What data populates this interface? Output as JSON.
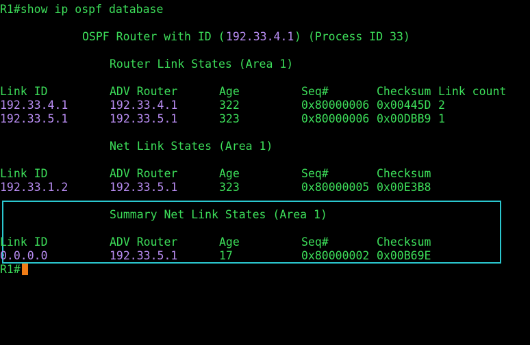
{
  "colors": {
    "background": "#000000",
    "text_green": "#3ddf5a",
    "ip_purple": "#b98df3",
    "highlight_box": "#2bc7cf",
    "cursor": "#f07c16"
  },
  "command_line": "R1#show ip ospf database",
  "header": {
    "prefix": "OSPF Router with ID (",
    "router_id": "192.33.4.1",
    "suffix": ") (Process ID 33)"
  },
  "router_section": {
    "title": "Router Link States (Area 1)",
    "columns": {
      "link_id": "Link ID",
      "adv_router": "ADV Router",
      "age": "Age",
      "seq": "Seq#",
      "checksum": "Checksum",
      "link_count": "Link count"
    },
    "rows": [
      {
        "link_id": "192.33.4.1",
        "adv_router": "192.33.4.1",
        "age": "322",
        "seq": "0x80000006",
        "checksum": "0x00445D",
        "link_count": "2"
      },
      {
        "link_id": "192.33.5.1",
        "adv_router": "192.33.5.1",
        "age": "323",
        "seq": "0x80000006",
        "checksum": "0x00DBB9",
        "link_count": "1"
      }
    ]
  },
  "net_section": {
    "title": "Net Link States (Area 1)",
    "columns": {
      "link_id": "Link ID",
      "adv_router": "ADV Router",
      "age": "Age",
      "seq": "Seq#",
      "checksum": "Checksum"
    },
    "rows": [
      {
        "link_id": "192.33.1.2",
        "adv_router": "192.33.5.1",
        "age": "323",
        "seq": "0x80000005",
        "checksum": "0x00E3B8"
      }
    ]
  },
  "summary_section": {
    "title": "Summary Net Link States (Area 1)",
    "columns": {
      "link_id": "Link ID",
      "adv_router": "ADV Router",
      "age": "Age",
      "seq": "Seq#",
      "checksum": "Checksum"
    },
    "rows": [
      {
        "link_id": "0.0.0.0",
        "adv_router": "192.33.5.1",
        "age": "17",
        "seq": "0x80000002",
        "checksum": "0x00B69E"
      }
    ]
  },
  "prompt": "R1#"
}
